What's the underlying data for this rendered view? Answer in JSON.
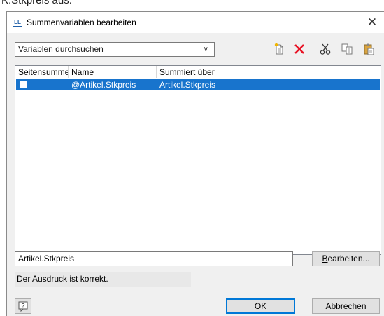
{
  "background_text": "K.Stkpreis aus.",
  "window": {
    "icon_label": "LL",
    "title": "Summenvariablen bearbeiten",
    "close_glyph": "✕"
  },
  "search": {
    "placeholder": "Variablen durchsuchen",
    "chevron_glyph": "∨"
  },
  "toolbar": {
    "icons": [
      "new-icon",
      "delete-icon",
      "cut-icon",
      "copy-icon",
      "paste-icon"
    ]
  },
  "table": {
    "columns": [
      "Seitensumme",
      "Name",
      "Summiert über"
    ],
    "rows": [
      {
        "checked": false,
        "name": "@Artikel.Stkpreis",
        "summed_over": "Artikel.Stkpreis",
        "selected": true
      }
    ]
  },
  "expression": {
    "value": "Artikel.Stkpreis"
  },
  "edit_button": {
    "label": "Bearbeiten...",
    "mnemonic": "B",
    "rest": "earbeiten..."
  },
  "status_text": "Der Ausdruck ist korrekt.",
  "help_glyph": "?",
  "ok_button": "OK",
  "cancel_button": "Abbrechen",
  "colors": {
    "selection": "#1874cd",
    "delete": "#e81123",
    "dialog_bg": "#f0f0f0",
    "ok_border": "#0078d7"
  }
}
